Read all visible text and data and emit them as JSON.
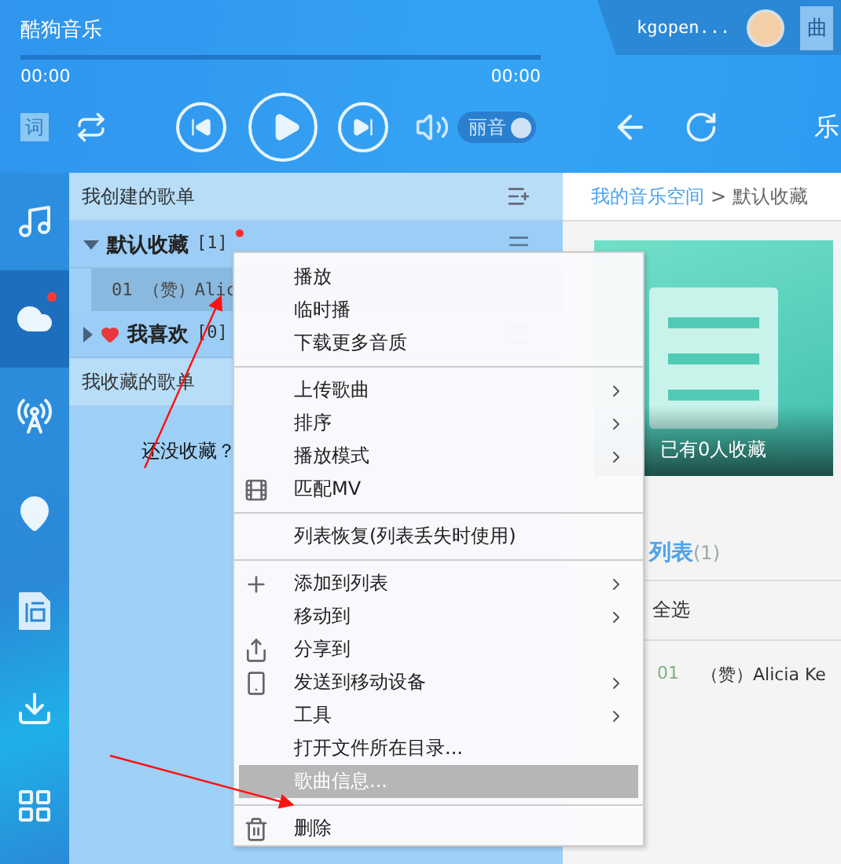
{
  "window": {
    "title": "酷狗音乐"
  },
  "user": {
    "name": "kgopen...",
    "tab_label": "曲"
  },
  "progress": {
    "level": 0,
    "elapsed": "00:00",
    "total": "00:00"
  },
  "controls": {
    "lyrics_label": "词",
    "sound_toggle": {
      "label": "丽音",
      "on": true
    },
    "nav_label": "乐"
  },
  "sidebar": {
    "items": [
      {
        "selected": false,
        "badge": false
      },
      {
        "selected": true,
        "badge": true
      },
      {
        "selected": false,
        "badge": false
      },
      {
        "selected": false,
        "badge": false
      },
      {
        "selected": false,
        "badge": false
      },
      {
        "selected": false,
        "badge": false
      },
      {
        "selected": false,
        "badge": false
      }
    ]
  },
  "playlists": {
    "created_title": "我创建的歌单",
    "lists": [
      {
        "name": "默认收藏",
        "count": "[1]",
        "expanded": true,
        "favorite": false,
        "unread": true,
        "songs": [
          {
            "text": "01 （赞）Alic"
          }
        ]
      },
      {
        "name": "我喜欢",
        "count": "[0]",
        "expanded": false,
        "favorite": true,
        "unread": false
      }
    ],
    "collected_title": "我收藏的歌单",
    "empty_text": "还没收藏？"
  },
  "detail": {
    "breadcrumb": [
      {
        "label": "我的音乐空间",
        "kind": "link"
      },
      {
        "label": ">",
        "kind": "separator"
      },
      {
        "label": "默认收藏",
        "kind": "current"
      }
    ],
    "cover_caption": "已有0人收藏",
    "list_heading": "列表",
    "list_count": "(1)",
    "select_all": "全选",
    "songs": [
      {
        "index": "01",
        "title": "（赞）Alicia Ke"
      }
    ]
  },
  "context_menu": [
    {
      "kind": "item",
      "label": "播放",
      "submenu": false,
      "selected": false
    },
    {
      "kind": "item",
      "label": "临时播",
      "submenu": false,
      "selected": false
    },
    {
      "kind": "item",
      "label": "下载更多音质",
      "submenu": false,
      "selected": false
    },
    {
      "kind": "divider"
    },
    {
      "kind": "item",
      "label": "上传歌曲",
      "submenu": true,
      "selected": false
    },
    {
      "kind": "item",
      "label": "排序",
      "submenu": true,
      "selected": false
    },
    {
      "kind": "item",
      "label": "播放模式",
      "submenu": true,
      "selected": false
    },
    {
      "kind": "item",
      "label": "匹配MV",
      "submenu": false,
      "selected": false
    },
    {
      "kind": "divider"
    },
    {
      "kind": "item",
      "label": "列表恢复(列表丢失时使用)",
      "submenu": false,
      "selected": false
    },
    {
      "kind": "divider"
    },
    {
      "kind": "item",
      "label": "添加到列表",
      "submenu": true,
      "selected": false
    },
    {
      "kind": "item",
      "label": "移动到",
      "submenu": true,
      "selected": false
    },
    {
      "kind": "item",
      "label": "分享到",
      "submenu": false,
      "selected": false
    },
    {
      "kind": "item",
      "label": "发送到移动设备",
      "submenu": true,
      "selected": false
    },
    {
      "kind": "item",
      "label": "工具",
      "submenu": true,
      "selected": false
    },
    {
      "kind": "item",
      "label": "打开文件所在目录...",
      "submenu": false,
      "selected": false
    },
    {
      "kind": "item",
      "label": "歌曲信息...",
      "submenu": false,
      "selected": true
    },
    {
      "kind": "divider"
    },
    {
      "kind": "item",
      "label": "删除",
      "submenu": false,
      "selected": false
    }
  ],
  "annotations": [
    {
      "kind": "arrow"
    },
    {
      "kind": "arrow"
    }
  ]
}
